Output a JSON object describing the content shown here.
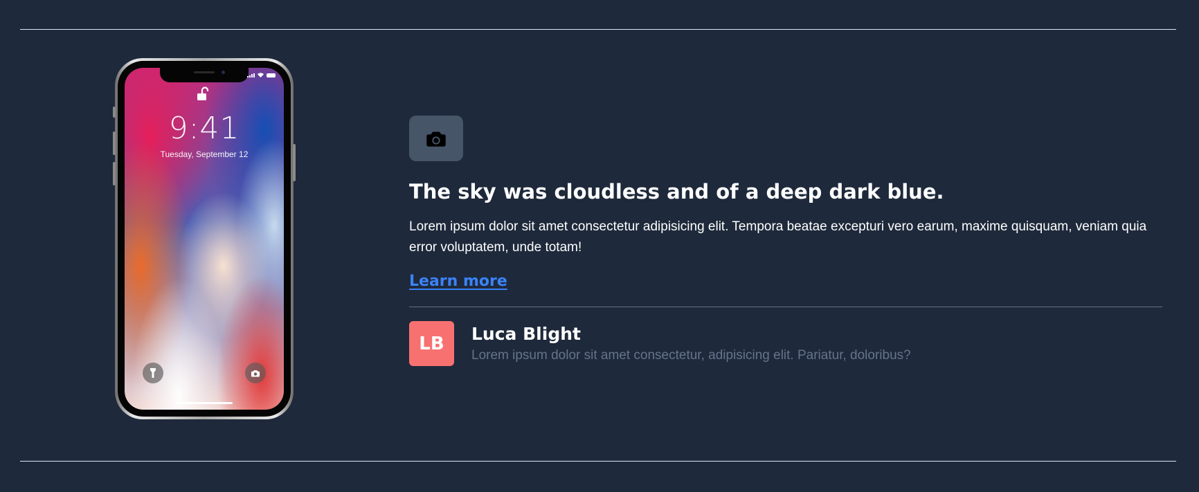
{
  "colors": {
    "background": "#1e293b",
    "icon_tile": "#475569",
    "link": "#3b82f6",
    "avatar": "#f87171",
    "muted_text": "#64748b",
    "rule": "#e2e8f0"
  },
  "phone": {
    "time": "9:41",
    "date": "Tuesday, September 12",
    "icons": [
      "lock-open-icon",
      "flashlight-icon",
      "camera-icon",
      "signal-icon",
      "wifi-icon",
      "battery-icon"
    ]
  },
  "feature": {
    "icon": "camera-icon",
    "title": "The sky was cloudless and of a deep dark blue.",
    "description": "Lorem ipsum dolor sit amet consectetur adipisicing elit. Tempora beatae excepturi vero earum, maxime quisquam, veniam quia error voluptatem, unde totam!",
    "link_label": "Learn more"
  },
  "author": {
    "initials": "LB",
    "name": "Luca Blight",
    "description": "Lorem ipsum dolor sit amet consectetur, adipisicing elit. Pariatur, doloribus?"
  }
}
